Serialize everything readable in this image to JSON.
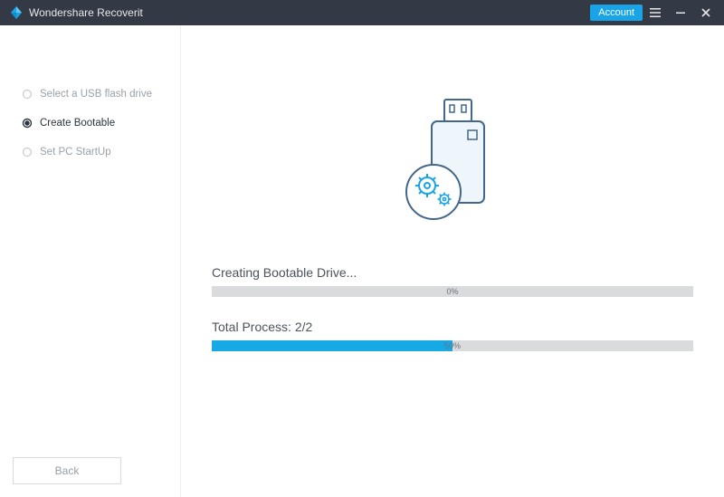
{
  "titlebar": {
    "app_title": "Wondershare Recoverit",
    "account_label": "Account"
  },
  "sidebar": {
    "steps": [
      {
        "label": "Select a USB flash drive",
        "active": false
      },
      {
        "label": "Create Bootable",
        "active": true
      },
      {
        "label": "Set PC StartUp",
        "active": false
      }
    ],
    "back_label": "Back"
  },
  "main": {
    "progress1": {
      "label": "Creating Bootable Drive...",
      "percent": 0,
      "percent_text": "0%"
    },
    "progress2": {
      "label": "Total Process: 2/2",
      "percent": 50,
      "percent_text": "50%"
    }
  },
  "colors": {
    "accent": "#17a9e6",
    "titlebar_bg": "#333a45"
  }
}
